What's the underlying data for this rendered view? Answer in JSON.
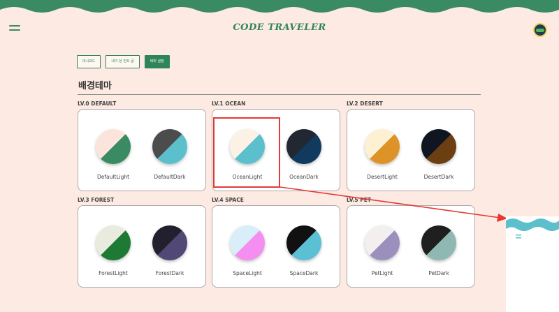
{
  "header": {
    "title": "CODE TRAVELER",
    "colors": {
      "wave": "#3a8b63",
      "accent": "#2f855a",
      "background": "#fdeae2"
    }
  },
  "tabs": [
    {
      "label": "대시보드",
      "active": false
    },
    {
      "label": "내가 쓴 힌트 글",
      "active": false
    },
    {
      "label": "테마 설정",
      "active": true
    }
  ],
  "section": {
    "title": "배경테마"
  },
  "levels": [
    {
      "label": "LV.0 DEFAULT",
      "themes": [
        {
          "name": "DefaultLight",
          "colors": [
            "#fbe4dc",
            "#3a8b63"
          ]
        },
        {
          "name": "DefaultDark",
          "colors": [
            "#4c4c4c",
            "#5cc0cc"
          ]
        }
      ]
    },
    {
      "label": "LV.1 OCEAN",
      "themes": [
        {
          "name": "OceanLight",
          "colors": [
            "#fbf1e4",
            "#5cc0cc"
          ]
        },
        {
          "name": "OceanDark",
          "colors": [
            "#222831",
            "#123a5e"
          ]
        }
      ]
    },
    {
      "label": "LV.2 DESERT",
      "themes": [
        {
          "name": "DesertLight",
          "colors": [
            "#fdf0d3",
            "#dd9328"
          ]
        },
        {
          "name": "DesertDark",
          "colors": [
            "#101522",
            "#6b3f12"
          ]
        }
      ]
    },
    {
      "label": "LV.3 FOREST",
      "themes": [
        {
          "name": "ForestLight",
          "colors": [
            "#e8ebdd",
            "#1d7a34"
          ]
        },
        {
          "name": "ForestDark",
          "colors": [
            "#22202e",
            "#524876"
          ]
        }
      ]
    },
    {
      "label": "LV.4 SPACE",
      "themes": [
        {
          "name": "SpaceLight",
          "colors": [
            "#d9eef8",
            "#f48ef0"
          ]
        },
        {
          "name": "SpaceDark",
          "colors": [
            "#111111",
            "#5cc0d4"
          ]
        }
      ]
    },
    {
      "label": "LV.5 PET",
      "themes": [
        {
          "name": "PetLight",
          "colors": [
            "#f3efee",
            "#9b90bd"
          ]
        },
        {
          "name": "PetDark",
          "colors": [
            "#1f1f1f",
            "#8fb8b3"
          ]
        }
      ]
    }
  ],
  "annotation": {
    "color": "#e53935"
  }
}
